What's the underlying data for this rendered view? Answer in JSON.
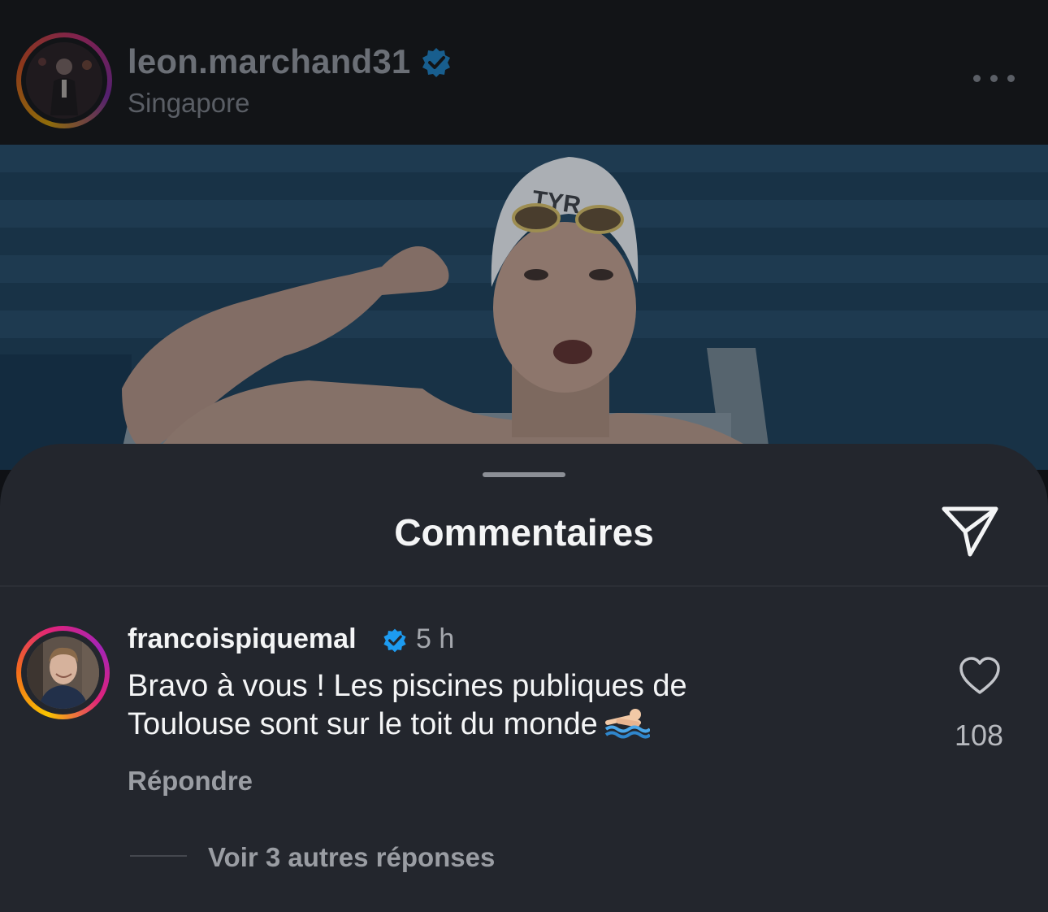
{
  "post": {
    "username": "leon.marchand31",
    "location": "Singapore",
    "verified": true,
    "more_icon": "ellipsis-icon",
    "photo_cap_text": "TYR"
  },
  "comments_sheet": {
    "title": "Commentaires",
    "share_icon": "paper-plane-icon",
    "comment": {
      "username": "francoispiquemal",
      "verified": true,
      "time": "5 h",
      "text_line1": "Bravo à vous ! Les piscines publiques de",
      "text_line2": "Toulouse sont sur le toit du monde",
      "emoji": "swimmer-emoji",
      "reply_label": "Répondre",
      "like_icon": "heart-outline-icon",
      "like_count": "108",
      "view_replies_label": "Voir 3 autres réponses"
    }
  },
  "colors": {
    "sheet_bg": "#23262d",
    "verified_blue": "#1d9bf0",
    "header_bg": "#121417"
  }
}
